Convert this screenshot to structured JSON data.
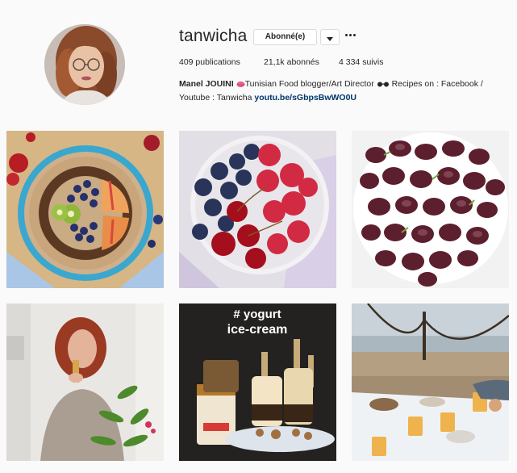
{
  "profile": {
    "username": "tanwicha",
    "follow_label": "Abonné(e)",
    "dropdown_icon": "chevron-down-icon",
    "more_icon": "ellipsis-icon",
    "stats": {
      "posts": "409 publications",
      "followers": "21,1k abonnés",
      "following": "4 334 suivis"
    },
    "bio": {
      "full_name": "Manel JOUINI",
      "text_part1": "Tunisian Food blogger/Art Director",
      "text_part2": "Recipes on : Facebook / Youtube : Tanwicha",
      "link": "youtu.be/sGbpsBwWO0U",
      "emoji1_icon": "lips-icon",
      "emoji2_icon": "glasses-icon"
    }
  },
  "posts": [
    {
      "icon": "post-oatmeal-bowl"
    },
    {
      "icon": "post-berries-bowl"
    },
    {
      "icon": "post-mulberries-bowl"
    },
    {
      "icon": "post-mirror-selfie"
    },
    {
      "icon": "post-yogurt-ice-cream",
      "title": "# yogurt",
      "subtitle": "ice-cream"
    },
    {
      "icon": "post-beach-breakfast"
    }
  ],
  "colors": {
    "background": "#fafafa",
    "text": "#262626",
    "link": "#003569",
    "border": "#dbdbdb"
  }
}
